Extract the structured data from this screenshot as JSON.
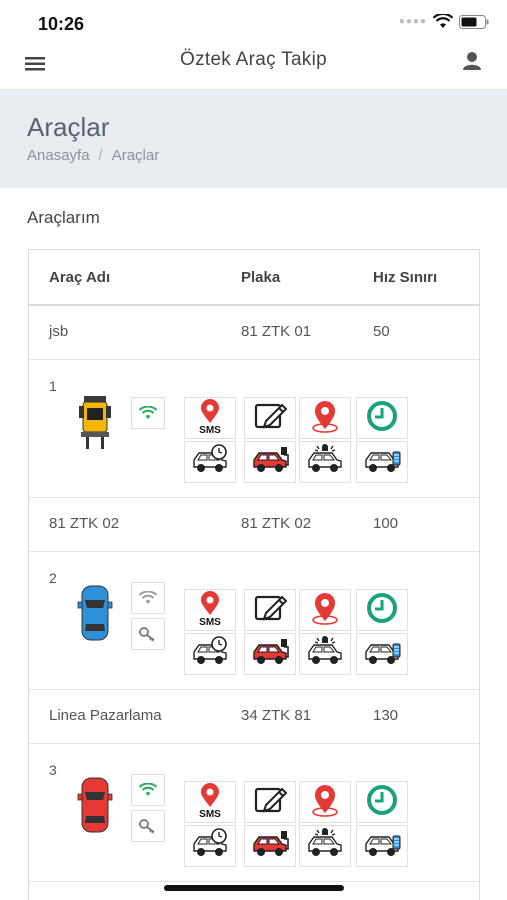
{
  "status_bar": {
    "time": "10:26"
  },
  "navbar": {
    "title": "Öztek Araç Takip"
  },
  "page": {
    "title": "Araçlar",
    "breadcrumb": [
      "Anasayfa",
      "/",
      "Araçlar"
    ]
  },
  "section": {
    "title": "Araçlarım"
  },
  "table": {
    "headers": [
      "Araç Adı",
      "Plaka",
      "Hız Sınırı"
    ],
    "rows": [
      {
        "name": "jsb",
        "plate": "81 ZTK 01",
        "speed": "50",
        "index": "1",
        "vehicle_icon": "forklift-icon",
        "vehicle_color": "#f2b705",
        "has_key": false,
        "wifi_color": "#27ae60"
      },
      {
        "name": "81 ZTK 02",
        "plate": "81 ZTK 02",
        "speed": "100",
        "index": "2",
        "vehicle_icon": "car-top-icon",
        "vehicle_color": "#2f8fd8",
        "has_key": true,
        "wifi_color": "#9e9e9e"
      },
      {
        "name": "Linea Pazarlama",
        "plate": "34 ZTK 81",
        "speed": "130",
        "index": "3",
        "vehicle_icon": "car-top-icon",
        "vehicle_color": "#e53935",
        "has_key": true,
        "wifi_color": "#27ae60"
      }
    ]
  },
  "actions": {
    "sms_label": "SMS",
    "icons": [
      "sms-location-icon",
      "edit-icon",
      "location-pin-icon",
      "clock-icon",
      "car-history-icon",
      "car-charge-icon",
      "car-alarm-icon",
      "car-fuel-icon"
    ]
  },
  "colors": {
    "header_bg": "#e9edf2",
    "accent_green": "#1aa37a",
    "accent_red": "#e53935"
  }
}
